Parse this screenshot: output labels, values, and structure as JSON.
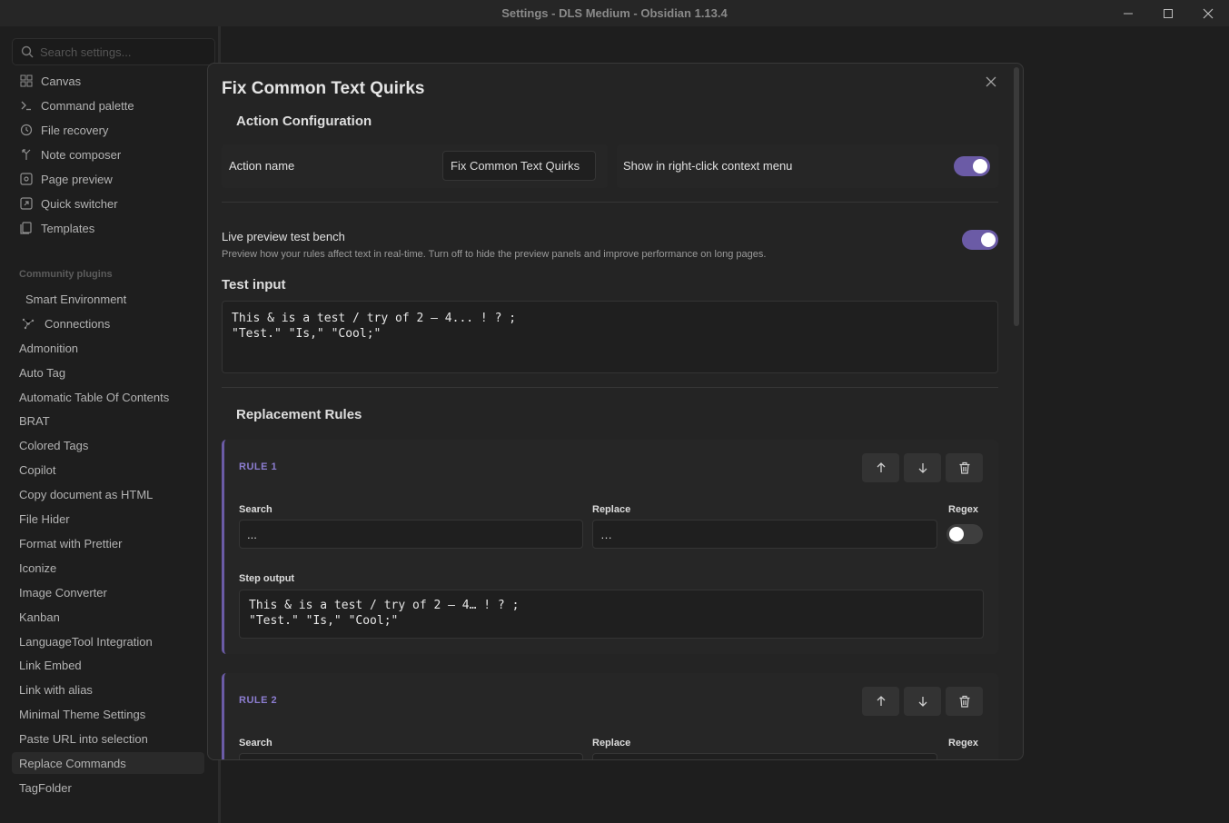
{
  "window": {
    "title": "Settings - DLS Medium - Obsidian 1.13.4"
  },
  "sidebar": {
    "search_placeholder": "Search settings...",
    "core_items": [
      {
        "label": "Canvas",
        "icon": "canvas-icon"
      },
      {
        "label": "Command palette",
        "icon": "terminal-icon"
      },
      {
        "label": "File recovery",
        "icon": "history-icon"
      },
      {
        "label": "Note composer",
        "icon": "merge-icon"
      },
      {
        "label": "Page preview",
        "icon": "preview-icon"
      },
      {
        "label": "Quick switcher",
        "icon": "switcher-icon"
      },
      {
        "label": "Templates",
        "icon": "templates-icon"
      }
    ],
    "community_heading": "Community plugins",
    "plugins": [
      {
        "label": "Smart Environment"
      },
      {
        "label": "Connections",
        "icon": "connections-icon"
      },
      {
        "label": "Admonition"
      },
      {
        "label": "Auto Tag"
      },
      {
        "label": "Automatic Table Of Contents"
      },
      {
        "label": "BRAT"
      },
      {
        "label": "Colored Tags"
      },
      {
        "label": "Copilot"
      },
      {
        "label": "Copy document as HTML"
      },
      {
        "label": "File Hider"
      },
      {
        "label": "Format with Prettier"
      },
      {
        "label": "Iconize"
      },
      {
        "label": "Image Converter"
      },
      {
        "label": "Kanban"
      },
      {
        "label": "LanguageTool Integration"
      },
      {
        "label": "Link Embed"
      },
      {
        "label": "Link with alias"
      },
      {
        "label": "Minimal Theme Settings"
      },
      {
        "label": "Paste URL into selection"
      },
      {
        "label": "Replace Commands",
        "active": true
      },
      {
        "label": "TagFolder"
      }
    ]
  },
  "modal": {
    "title": "Fix Common Text Quirks",
    "action_config_heading": "Action Configuration",
    "action_name_label": "Action name",
    "action_name_value": "Fix Common Text Quirks",
    "context_menu_label": "Show in right-click context menu",
    "context_menu_enabled": true,
    "live_preview_label": "Live preview test bench",
    "live_preview_desc": "Preview how your rules affect text in real-time. Turn off to hide the preview panels and improve performance on long pages.",
    "live_preview_enabled": true,
    "test_input_heading": "Test input",
    "test_input_value": "This & is a test / try of 2 – 4... ! ? ;\n\"Test.\" \"Is,\" \"Cool;\"",
    "replacement_rules_heading": "Replacement Rules",
    "rules": [
      {
        "title": "RULE 1",
        "search_label": "Search",
        "search_value": "...",
        "replace_label": "Replace",
        "replace_value": "…",
        "regex_label": "Regex",
        "regex_enabled": false,
        "step_output_label": "Step output",
        "step_output_value": "This & is a test / try of 2 – 4… ! ? ;\n\"Test.\" \"Is,\" \"Cool;\""
      },
      {
        "title": "RULE 2",
        "search_label": "Search",
        "replace_label": "Replace",
        "regex_label": "Regex"
      }
    ]
  },
  "colors": {
    "accent": "#6b5ba6",
    "rule_title": "#8c7dd0",
    "background": "#1e1e1e",
    "modal_bg": "#242424"
  }
}
